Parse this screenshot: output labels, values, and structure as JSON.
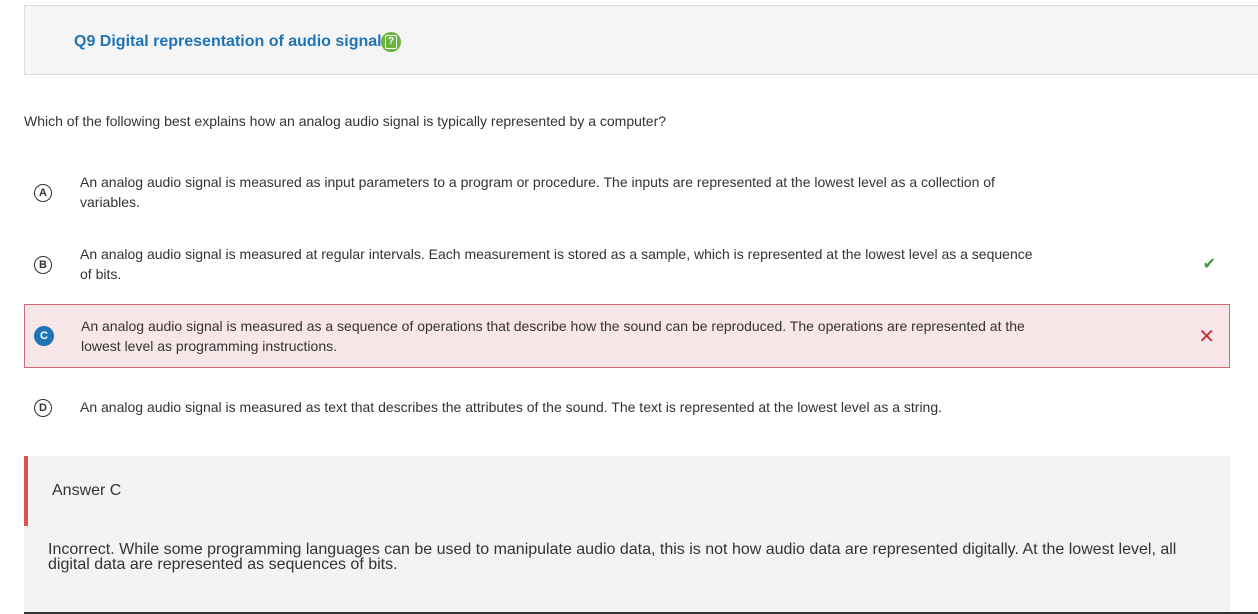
{
  "header": {
    "question_title": "Q9 Digital representation of audio signal",
    "help_icon": "question-mark-icon",
    "help_icon_color": "#6ab33e"
  },
  "question": {
    "text": "Which of the following best explains how an analog audio signal is typically represented by a computer?"
  },
  "options": [
    {
      "letter": "A",
      "text": "An analog audio signal is measured as input parameters to a program or procedure. The inputs are represented at the lowest level as a collection of variables.",
      "state": "none"
    },
    {
      "letter": "B",
      "text": "An analog audio signal is measured at regular intervals. Each measurement is stored as a sample, which is represented at the lowest level as a sequence of bits.",
      "state": "correct",
      "mark": "✔"
    },
    {
      "letter": "C",
      "text": "An analog audio signal is measured as a sequence of operations that describe how the sound can be reproduced. The operations are represented at the lowest level as programming instructions.",
      "state": "selected-incorrect",
      "mark": "✕"
    },
    {
      "letter": "D",
      "text": "An analog audio signal is measured as text that describes the attributes of the sound. The text is represented at the lowest level as a string.",
      "state": "none"
    }
  ],
  "feedback": {
    "answer_label": "Answer C",
    "explanation": "Incorrect. While some programming languages can be used to manipulate audio data, this is not how audio data are represented digitally. At the lowest level, all digital data are represented as sequences of bits."
  },
  "colors": {
    "title_blue": "#1f74b8",
    "correct_green": "#3e9b3a",
    "incorrect_red": "#c9323f",
    "incorrect_bg": "#f8e6e8"
  }
}
